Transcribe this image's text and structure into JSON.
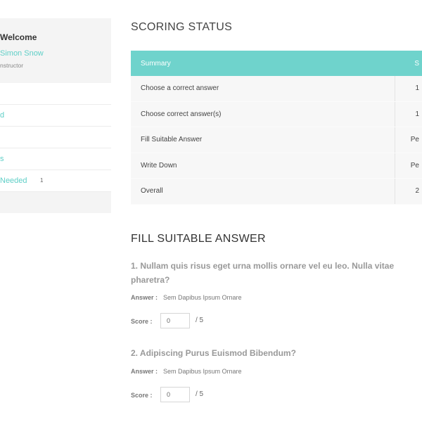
{
  "sidebar": {
    "welcome": "Welcome",
    "user_name": "Simon Snow",
    "user_role": "nstructor",
    "nav": [
      {
        "label": ""
      },
      {
        "label": "d"
      },
      {
        "label": ""
      },
      {
        "label": "s"
      },
      {
        "label": " Needed",
        "badge": "1"
      }
    ]
  },
  "scoring": {
    "title": "SCORING STATUS",
    "header": {
      "summary": "Summary",
      "score": "S"
    },
    "rows": [
      {
        "label": "Choose a correct answer",
        "value": "1"
      },
      {
        "label": "Choose correct answer(s)",
        "value": "1"
      },
      {
        "label": "Fill Suitable Answer",
        "value": "Pe"
      },
      {
        "label": "Write Down",
        "value": "Pe"
      },
      {
        "label": "Overall",
        "value": "2"
      }
    ]
  },
  "fill": {
    "title": "FILL SUITABLE ANSWER",
    "questions": [
      {
        "text": "1. Nullam quis risus eget urna mollis ornare vel eu leo. Nulla vitae pharetra?",
        "answer_label": "Answer :",
        "answer": "Sem Dapibus Ipsum Ornare",
        "score_label": "Score :",
        "score_value": "0",
        "score_max": "/ 5"
      },
      {
        "text": "2. Adipiscing Purus Euismod Bibendum?",
        "answer_label": "Answer :",
        "answer": "Sem Dapibus Ipsum Ornare",
        "score_label": "Score :",
        "score_value": "0",
        "score_max": "/ 5"
      }
    ]
  },
  "colors": {
    "accent": "#6fd3cc",
    "link": "#5fcfc7",
    "sidebar_bg": "#f4f4f4"
  }
}
